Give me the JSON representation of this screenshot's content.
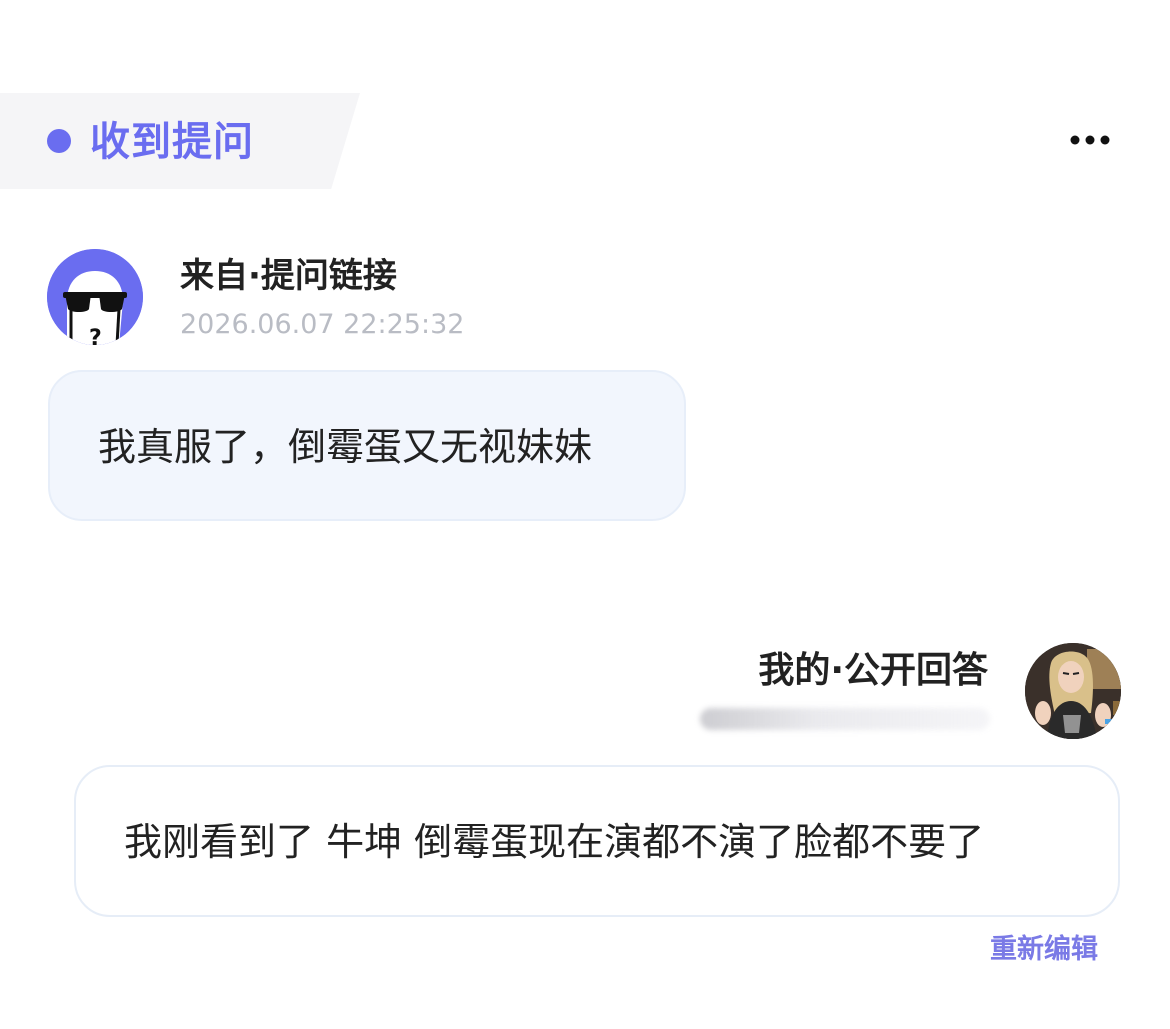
{
  "header": {
    "title": "收到提问",
    "more_icon": "more-horizontal-icon"
  },
  "question": {
    "source_label": "来自·提问链接",
    "timestamp": "2026.06.07 22:25:32",
    "text": "我真服了，倒霉蛋又无视妹妹",
    "avatar_icon": "anonymous-sunglasses-avatar"
  },
  "answer": {
    "label": "我的·公开回答",
    "text": "我刚看到了 牛坤 倒霉蛋现在演都不演了脸都不要了",
    "edit_label": "重新编辑"
  },
  "colors": {
    "accent": "#6a6df0",
    "question_bg": "#f2f6fd",
    "text": "#222222",
    "muted": "#b9bcc4"
  }
}
